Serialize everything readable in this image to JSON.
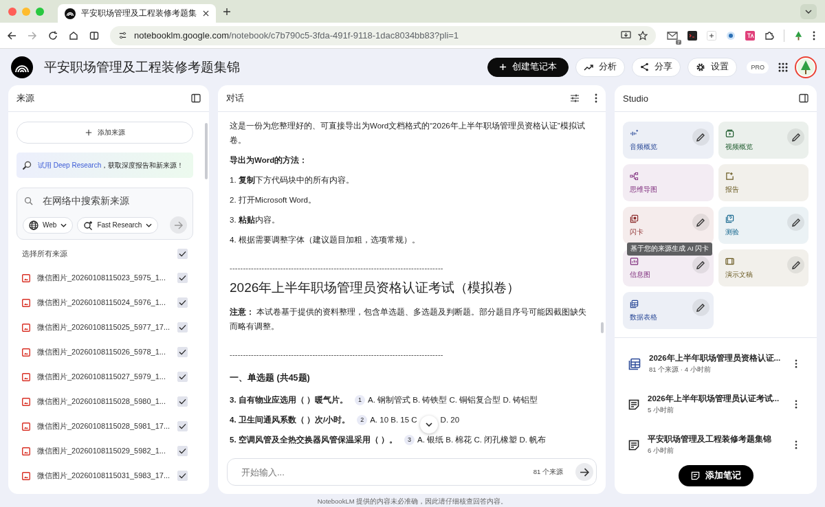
{
  "browser": {
    "tab_title": "平安职场管理及工程装修考题集",
    "url_host": "notebooklm.google.com",
    "url_path": "/notebook/c7b790c5-3fda-491f-9118-1dac8034bb83?pli=1",
    "extension_badge": "7"
  },
  "header": {
    "title": "平安职场管理及工程装修考题集锦",
    "buttons": [
      {
        "kind": "create",
        "label": "创建笔记本"
      },
      {
        "kind": "analytics",
        "label": "分析"
      },
      {
        "kind": "share",
        "label": "分享"
      },
      {
        "kind": "settings",
        "label": "设置"
      }
    ],
    "plan_badge": "PRO"
  },
  "sources": {
    "title": "来源",
    "add_button": "添加来源",
    "promo": {
      "link": "试用 Deep Research",
      "text": "，获取深度报告和新来源！"
    },
    "search": {
      "placeholder": "在网络中搜索新来源",
      "chips": [
        {
          "kind": "web",
          "label": "Web"
        },
        {
          "kind": "research",
          "label": "Fast Research"
        }
      ]
    },
    "select_all": {
      "label": "选择所有来源",
      "checked": true
    },
    "items": [
      {
        "name": "微信图片_20260108115023_5975_1...",
        "checked": true
      },
      {
        "name": "微信图片_20260108115024_5976_1...",
        "checked": true
      },
      {
        "name": "微信图片_20260108115025_5977_17...",
        "checked": true
      },
      {
        "name": "微信图片_20260108115026_5978_1...",
        "checked": true
      },
      {
        "name": "微信图片_20260108115027_5979_1...",
        "checked": true
      },
      {
        "name": "微信图片_20260108115028_5980_1...",
        "checked": true
      },
      {
        "name": "微信图片_20260108115028_5981_17...",
        "checked": true
      },
      {
        "name": "微信图片_20260108115029_5982_1...",
        "checked": true
      },
      {
        "name": "微信图片_20260108115031_5983_17...",
        "checked": true
      }
    ]
  },
  "chat": {
    "title": "对话",
    "blocks": [
      {
        "kind": "paragraph",
        "text": "这是一份为您整理好的、可直接导出为Word文档格式的“2026年上半年职场管理员资格认证”模拟试卷。"
      },
      {
        "kind": "subheading",
        "text": "导出为Word的方法："
      },
      {
        "kind": "paragraph",
        "text": "1. **复制**下方代码块中的所有内容。"
      },
      {
        "kind": "paragraph",
        "text": "2. 打开Microsoft Word。"
      },
      {
        "kind": "paragraph",
        "text": "3. **粘贴**内容。"
      },
      {
        "kind": "paragraph",
        "text": "4. 根据需要调整字体（建议题目加粗，选项常规）。"
      },
      {
        "kind": "rule",
        "text": "--------------------------------------------------------------------------------"
      },
      {
        "kind": "title",
        "text": "2026年上半年职场管理员资格认证考试（模拟卷）"
      },
      {
        "kind": "paragraph",
        "text": "**注意：** 本试卷基于提供的资料整理，包含单选题、多选题及判断题。部分题目序号可能因截图缺失而略有调整。"
      },
      {
        "kind": "rule",
        "text": "--------------------------------------------------------------------------------"
      },
      {
        "kind": "section",
        "text": "一、单选题 (共45题)"
      },
      {
        "kind": "question",
        "question": "3. 自有物业应选用（ ）暖气片。",
        "citation": "1",
        "options": [
          "A. 钢制管式 B. 铸铁型 C. 铜铝复合型 D. 铸铝型"
        ]
      },
      {
        "kind": "question",
        "question": "4. 卫生间通风系数（ ）次/小时。",
        "citation": "2",
        "options": [
          "A. 10 B. 15 C",
          "D. 20"
        ]
      },
      {
        "kind": "question",
        "question": "5. 空调风管及全热交换器风管保温采用（ ）。",
        "citation": "3",
        "options": [
          "A. 银纸 B. 棉花 C. 闭孔橡塑 D. 帆布"
        ]
      }
    ],
    "input": {
      "placeholder": "开始输入...",
      "source_count": "81 个来源"
    }
  },
  "studio": {
    "title": "Studio",
    "tools": [
      {
        "kind": "audio",
        "label": "音频概览",
        "editable": true
      },
      {
        "kind": "video",
        "label": "视频概览",
        "editable": true
      },
      {
        "kind": "mindmap",
        "label": "思维导图",
        "editable": false
      },
      {
        "kind": "report",
        "label": "报告",
        "editable": false
      },
      {
        "kind": "flashcards",
        "label": "闪卡",
        "editable": true
      },
      {
        "kind": "quiz",
        "label": "测验",
        "editable": true
      },
      {
        "kind": "infographic",
        "label": "信息图",
        "editable": true
      },
      {
        "kind": "slides",
        "label": "演示文稿",
        "editable": true
      },
      {
        "kind": "table",
        "label": "数据表格",
        "editable": true
      }
    ],
    "tooltip": "基于您的来源生成 AI 闪卡",
    "notes": [
      {
        "kind": "table",
        "title": "2026年上半年职场管理员资格认证...",
        "meta": "81 个来源 · 4 小时前"
      },
      {
        "kind": "note",
        "title": "2026年上半年职场管理员认证考试...",
        "meta": "5 小时前"
      },
      {
        "kind": "note",
        "title": "平安职场管理及工程装修考题集锦",
        "meta": "6 小时前"
      }
    ],
    "add_note": "添加笔记"
  },
  "footer": "NotebookLM 提供的内容未必准确，因此请仔细核查回答内容。"
}
